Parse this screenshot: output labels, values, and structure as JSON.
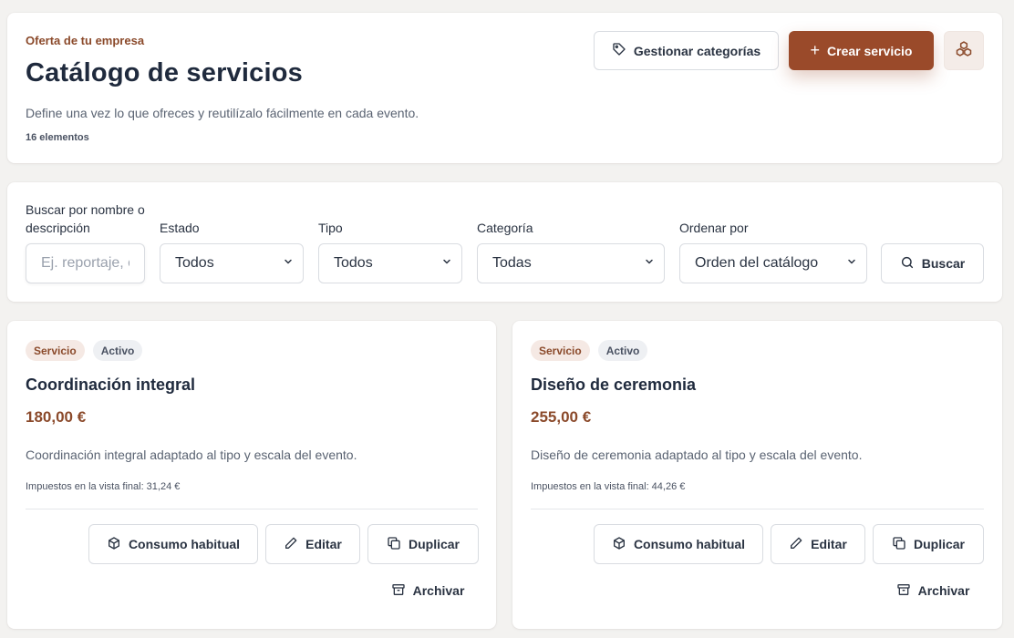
{
  "header": {
    "eyebrow": "Oferta de tu empresa",
    "title": "Catálogo de servicios",
    "subtitle": "Define una vez lo que ofreces y reutilízalo fácilmente en cada evento.",
    "count": "16 elementos",
    "manage_categories_label": "Gestionar categorías",
    "create_service_label": "Crear servicio",
    "create_service_icon": "plus-icon",
    "manage_categories_icon": "tag-icon",
    "extra_button_icon": "cubes-icon"
  },
  "filters": {
    "search_label": "Buscar por nombre o descripción",
    "search_placeholder": "Ej. reportaje, catering",
    "estado_label": "Estado",
    "estado_value": "Todos",
    "tipo_label": "Tipo",
    "tipo_value": "Todos",
    "categoria_label": "Categoría",
    "categoria_value": "Todas",
    "ordenar_label": "Ordenar por",
    "ordenar_value": "Orden del catálogo",
    "search_button_label": "Buscar"
  },
  "services": [
    {
      "type_badge": "Servicio",
      "status_badge": "Activo",
      "title": "Coordinación integral",
      "price": "180,00 €",
      "description": "Coordinación integral adaptado al tipo y escala del evento.",
      "tax_note": "Impuestos en la vista final: 31,24 €",
      "actions": {
        "consumo": "Consumo habitual",
        "editar": "Editar",
        "duplicar": "Duplicar",
        "archivar": "Archivar"
      }
    },
    {
      "type_badge": "Servicio",
      "status_badge": "Activo",
      "title": "Diseño de ceremonia",
      "price": "255,00 €",
      "description": "Diseño de ceremonia adaptado al tipo y escala del evento.",
      "tax_note": "Impuestos en la vista final: 44,26 €",
      "actions": {
        "consumo": "Consumo habitual",
        "editar": "Editar",
        "duplicar": "Duplicar",
        "archivar": "Archivar"
      }
    }
  ],
  "colors": {
    "accent": "#9a4a2a",
    "accent_text": "#8b4a2b",
    "background": "#f3f2f0",
    "heading": "#1f2a3d"
  }
}
